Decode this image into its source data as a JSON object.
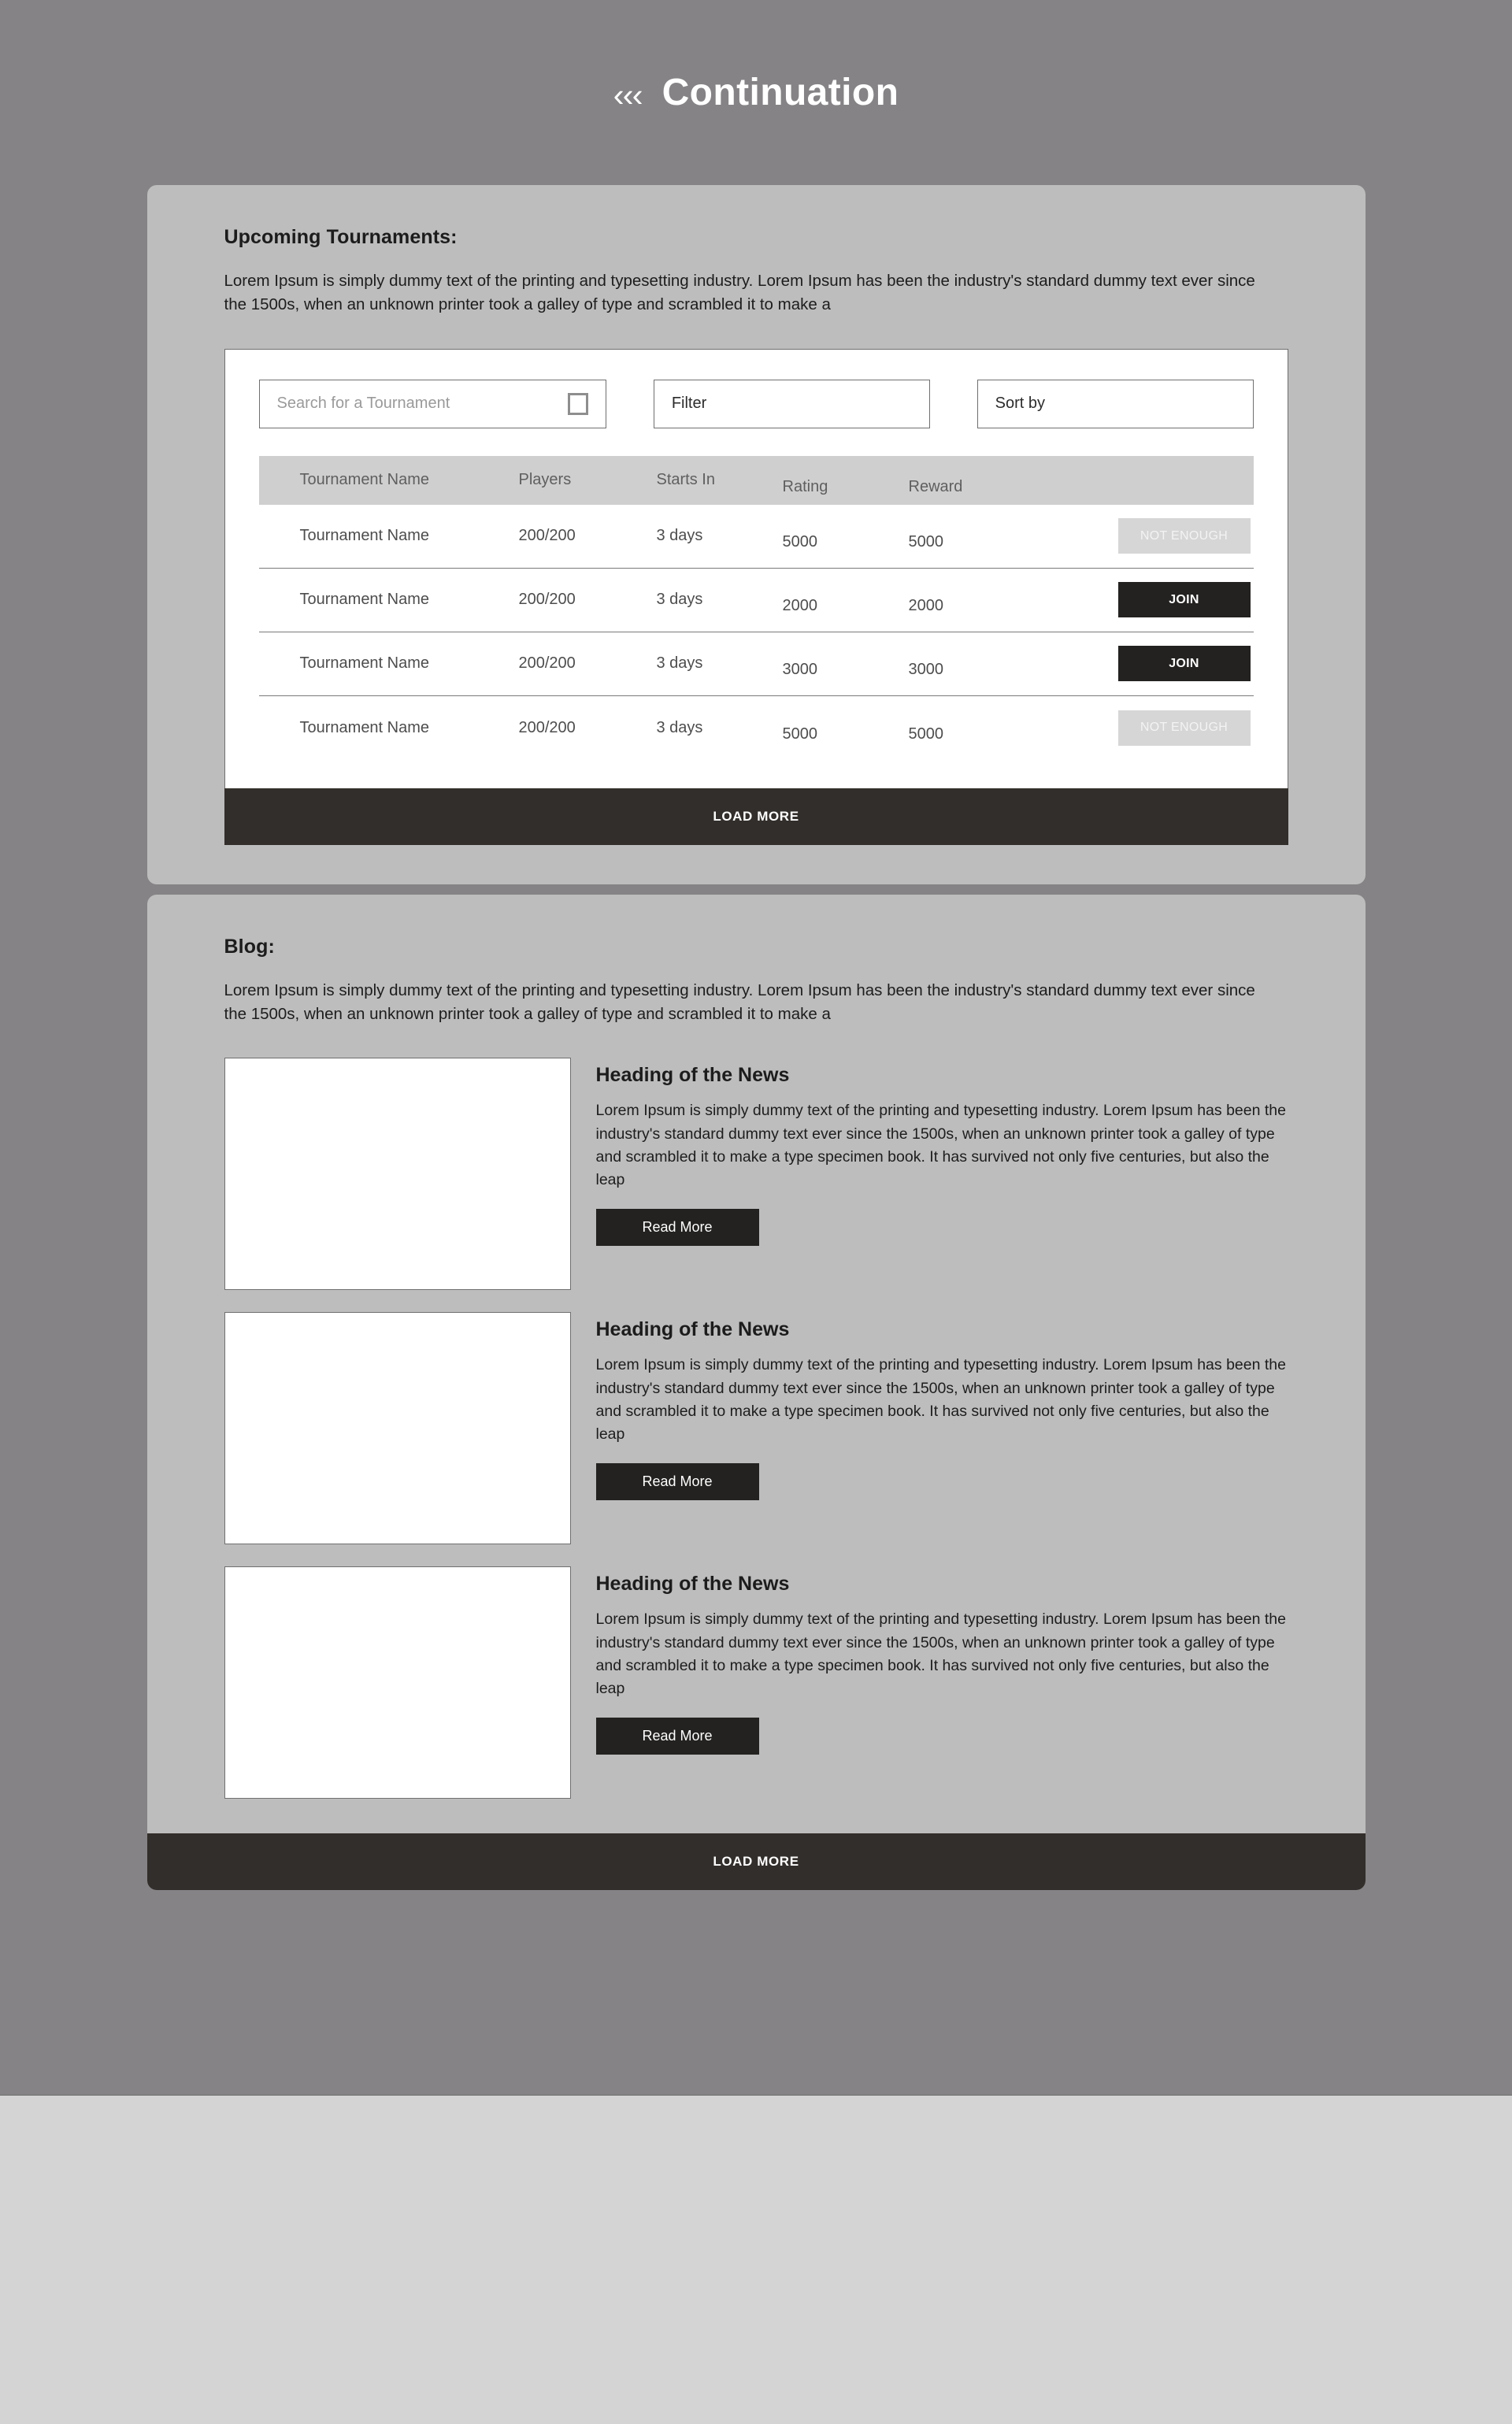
{
  "header": {
    "back_chevrons": "‹‹‹",
    "title": "Continuation"
  },
  "tournaments_panel": {
    "heading": "Upcoming Tournaments:",
    "description": "Lorem Ipsum is simply dummy text of the printing and typesetting industry. Lorem Ipsum has been the industry's standard dummy text ever since the 1500s, when an unknown printer took a galley of type and scrambled it to make a",
    "controls": {
      "search_placeholder": "Search for a Tournament",
      "search_value": "",
      "search_icon": "search-square-icon",
      "filter_label": "Filter",
      "sort_label": "Sort by"
    },
    "table": {
      "columns": [
        "Tournament Name",
        "Players",
        "Starts In",
        "Rating",
        "Reward",
        ""
      ],
      "rows": [
        {
          "name": "Tournament Name",
          "players": "200/200",
          "starts_in": "3 days",
          "rating": "5000",
          "reward": "5000",
          "action_label": "NOT ENOUGH",
          "action_state": "disabled"
        },
        {
          "name": "Tournament Name",
          "players": "200/200",
          "starts_in": "3 days",
          "rating": "2000",
          "reward": "2000",
          "action_label": "JOIN",
          "action_state": "enabled"
        },
        {
          "name": "Tournament Name",
          "players": "200/200",
          "starts_in": "3 days",
          "rating": "3000",
          "reward": "3000",
          "action_label": "JOIN",
          "action_state": "enabled"
        },
        {
          "name": "Tournament Name",
          "players": "200/200",
          "starts_in": "3 days",
          "rating": "5000",
          "reward": "5000",
          "action_label": "NOT ENOUGH",
          "action_state": "disabled"
        }
      ]
    },
    "load_more_label": "LOAD MORE"
  },
  "blog_panel": {
    "heading": "Blog:",
    "description": "Lorem Ipsum is simply dummy text of the printing and typesetting industry. Lorem Ipsum has been the industry's standard dummy text ever since the 1500s, when an unknown printer took a galley of type and scrambled it to make a",
    "posts": [
      {
        "title": "Heading of the News",
        "text": "Lorem Ipsum is simply dummy text of the printing and typesetting industry. Lorem Ipsum has been the industry's standard dummy text ever since the 1500s, when an unknown printer took a galley of type and scrambled it to make a type specimen book. It has survived not only five centuries, but also the leap",
        "read_more_label": "Read More"
      },
      {
        "title": "Heading of the News",
        "text": "Lorem Ipsum is simply dummy text of the printing and typesetting industry. Lorem Ipsum has been the industry's standard dummy text ever since the 1500s, when an unknown printer took a galley of type and scrambled it to make a type specimen book. It has survived not only five centuries, but also the leap",
        "read_more_label": "Read More"
      },
      {
        "title": "Heading of the News",
        "text": "Lorem Ipsum is simply dummy text of the printing and typesetting industry. Lorem Ipsum has been the industry's standard dummy text ever since the 1500s, when an unknown printer took a galley of type and scrambled it to make a type specimen book. It has survived not only five centuries, but also the leap",
        "read_more_label": "Read More"
      }
    ],
    "load_more_label": "LOAD MORE"
  },
  "colors": {
    "page_background": "#858385",
    "panel_background": "#bdbdbd",
    "card_background": "#ffffff",
    "dark_button": "#232220",
    "loadmore_bar": "#322e2b",
    "disabled_button": "#d6d6d6",
    "table_header": "#cfcfcf",
    "footer": "#d4d4d4"
  }
}
